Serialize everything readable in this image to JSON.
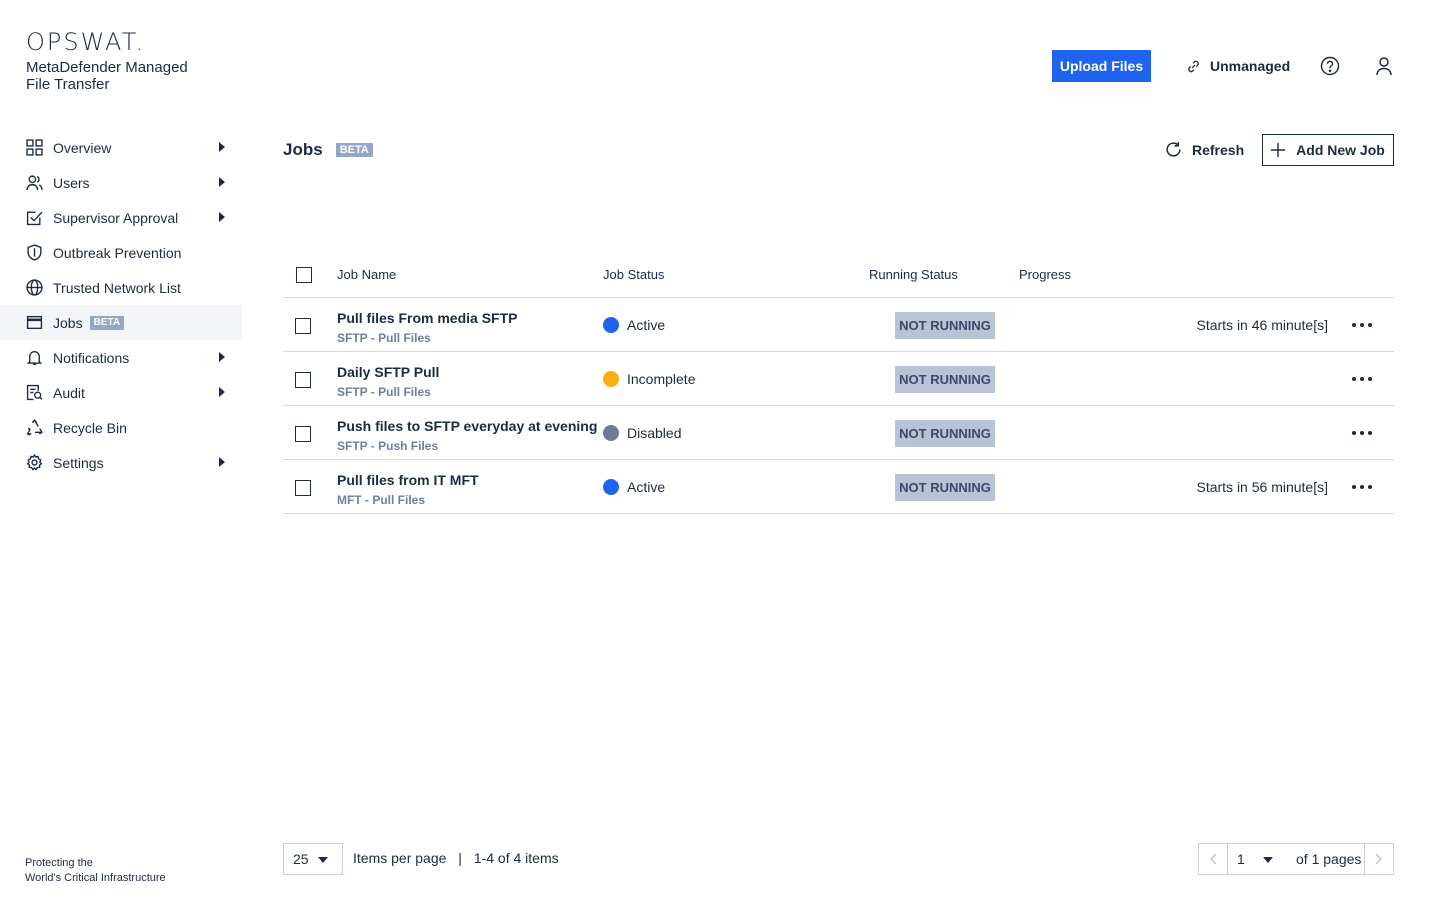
{
  "brand": {
    "logo": "OPSWAT.",
    "product": "MetaDefender Managed File Transfer",
    "tagline_line1": "Protecting the",
    "tagline_line2": "World's Critical Infrastructure"
  },
  "sidebar": {
    "items": [
      {
        "label": "Overview",
        "icon": "grid-icon",
        "has_submenu": true
      },
      {
        "label": "Users",
        "icon": "users-icon",
        "has_submenu": true
      },
      {
        "label": "Supervisor Approval",
        "icon": "approval-icon",
        "has_submenu": true
      },
      {
        "label": "Outbreak Prevention",
        "icon": "shield-icon",
        "has_submenu": false
      },
      {
        "label": "Trusted Network List",
        "icon": "globe-icon",
        "has_submenu": false
      },
      {
        "label": "Jobs",
        "icon": "window-icon",
        "has_submenu": false,
        "badge": "BETA",
        "active": true
      },
      {
        "label": "Notifications",
        "icon": "bell-icon",
        "has_submenu": true
      },
      {
        "label": "Audit",
        "icon": "audit-icon",
        "has_submenu": true
      },
      {
        "label": "Recycle Bin",
        "icon": "recycle-icon",
        "has_submenu": false
      },
      {
        "label": "Settings",
        "icon": "gear-icon",
        "has_submenu": true
      }
    ]
  },
  "header": {
    "upload_label": "Upload Files",
    "unmanaged_label": "Unmanaged"
  },
  "page": {
    "title": "Jobs",
    "title_badge": "BETA",
    "refresh_label": "Refresh",
    "add_job_label": "Add New Job"
  },
  "table": {
    "columns": [
      "Job Name",
      "Job Status",
      "Running Status",
      "Progress"
    ],
    "rows": [
      {
        "name": "Pull files From media SFTP",
        "type": "SFTP - Pull Files",
        "status": "Active",
        "status_color": "#1f64ef",
        "running": "NOT RUNNING",
        "schedule": "Starts in 46 minute[s]"
      },
      {
        "name": "Daily SFTP Pull",
        "type": "SFTP - Pull Files",
        "status": "Incomplete",
        "status_color": "#fbad14",
        "running": "NOT RUNNING",
        "schedule": ""
      },
      {
        "name": "Push files to SFTP everyday at evening",
        "type": "SFTP - Push Files",
        "status": "Disabled",
        "status_color": "#717a94",
        "running": "NOT RUNNING",
        "schedule": ""
      },
      {
        "name": "Pull files from IT MFT",
        "type": "MFT - Pull Files",
        "status": "Active",
        "status_color": "#1f64ef",
        "running": "NOT RUNNING",
        "schedule": "Starts in 56 minute[s]"
      }
    ]
  },
  "footer": {
    "per_page_value": "25",
    "per_page_label": "Items per page",
    "separator": "|",
    "range_label": "1-4 of 4 items",
    "page_value": "1",
    "page_of_label": "of 1 pages"
  }
}
